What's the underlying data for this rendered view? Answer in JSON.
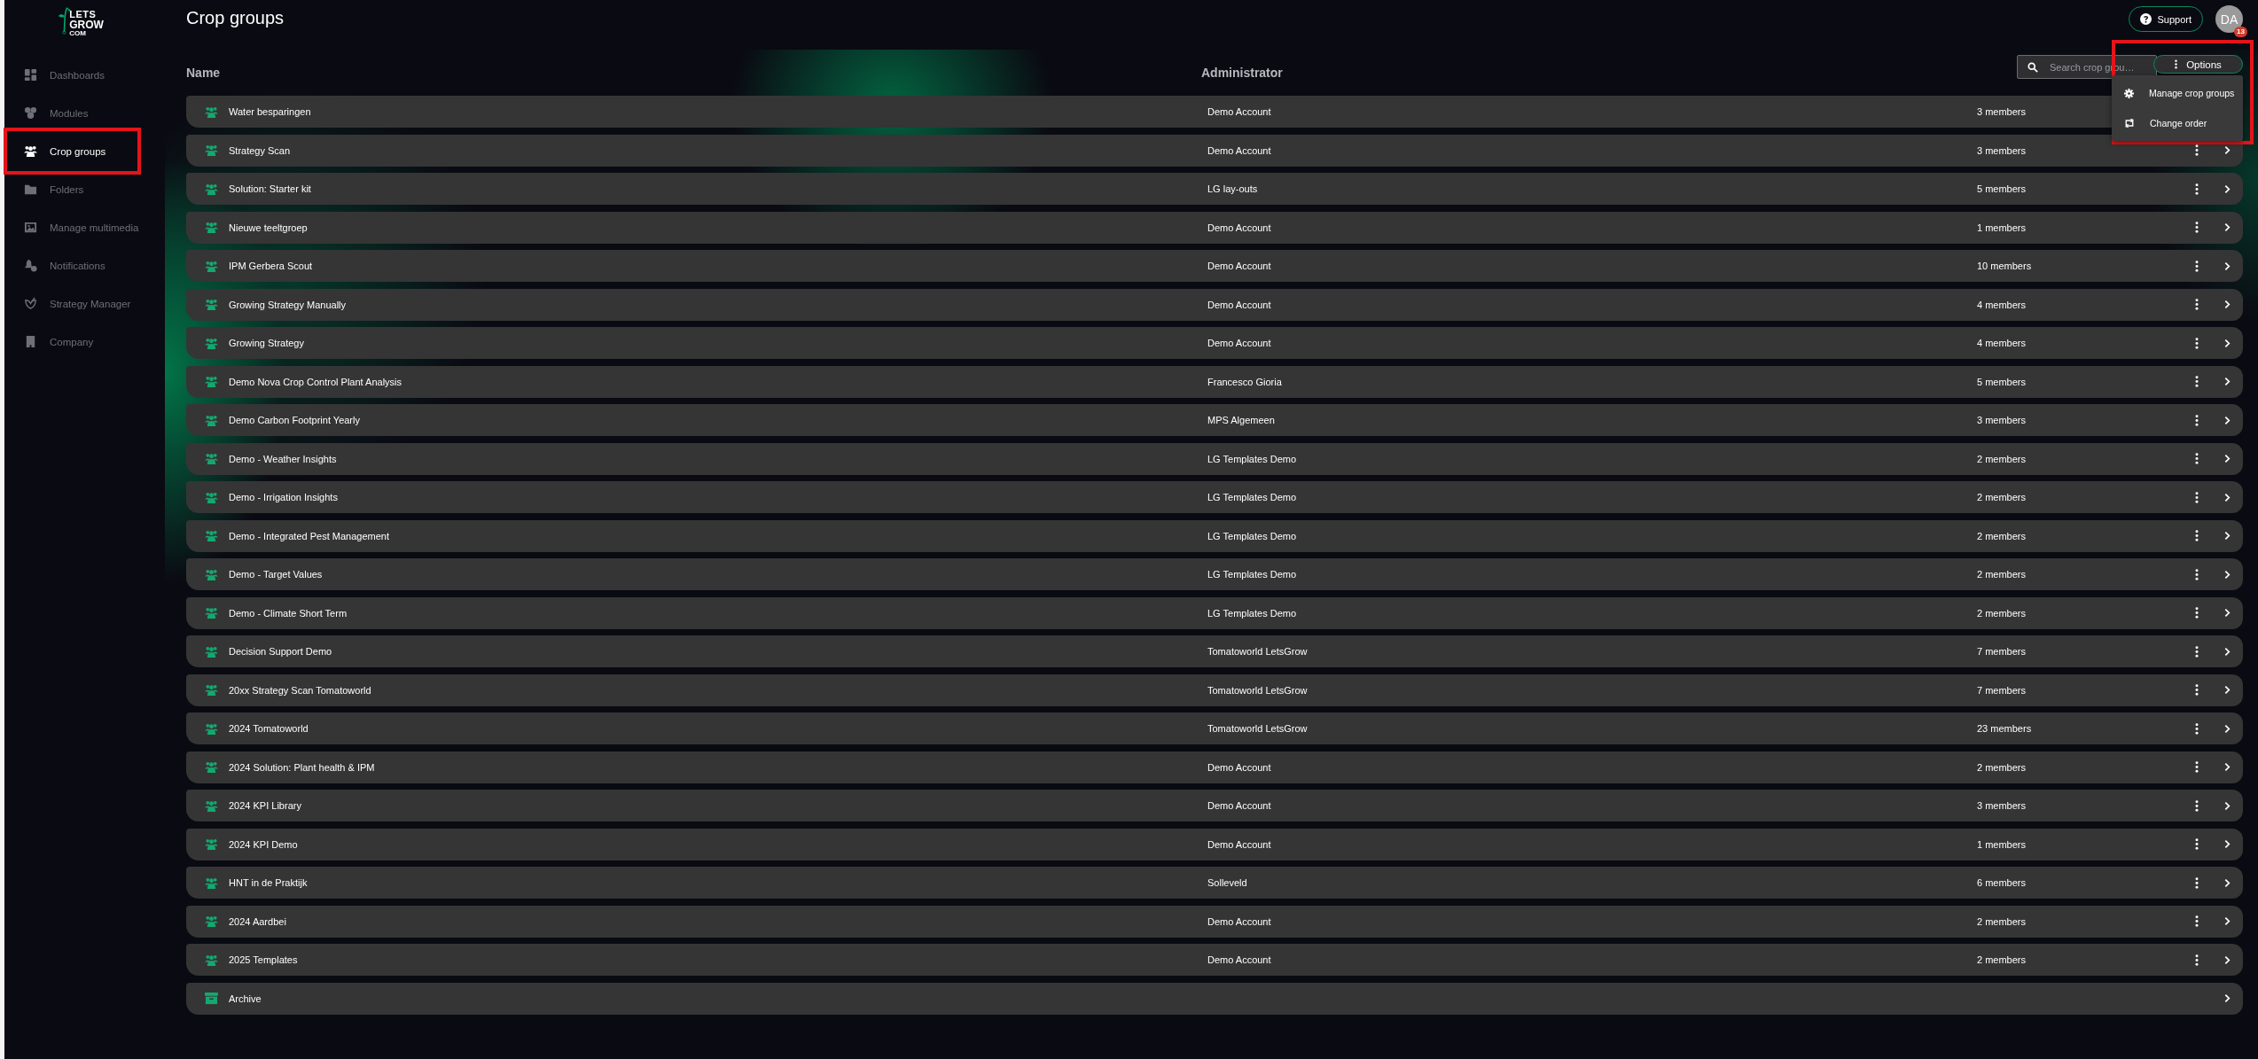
{
  "logo": {
    "line1": "LETS",
    "line2": "GROW",
    "line3": "COM"
  },
  "sidebar": {
    "items": [
      {
        "label": "Dashboards",
        "selected": false,
        "highlighted": false
      },
      {
        "label": "Modules",
        "selected": false,
        "highlighted": false
      },
      {
        "label": "Crop groups",
        "selected": true,
        "highlighted": true
      },
      {
        "label": "Folders",
        "selected": false,
        "highlighted": false
      },
      {
        "label": "Manage multimedia",
        "selected": false,
        "highlighted": false
      },
      {
        "label": "Notifications",
        "selected": false,
        "highlighted": false
      },
      {
        "label": "Strategy Manager",
        "selected": false,
        "highlighted": false
      },
      {
        "label": "Company",
        "selected": false,
        "highlighted": false
      }
    ]
  },
  "header": {
    "title": "Crop groups",
    "support": "Support",
    "avatar": "DA",
    "badge": "13"
  },
  "table": {
    "columns": [
      "Name",
      "Administrator"
    ],
    "search": {
      "placeholder": "Search crop grou…"
    },
    "options": {
      "label": "Options",
      "highlighted": true,
      "menu": [
        "Manage crop groups",
        "Change order"
      ]
    },
    "rows": [
      {
        "kind": "group",
        "name": "Water besparingen",
        "admin": "Demo Account",
        "members": "3 members"
      },
      {
        "kind": "group",
        "name": "Strategy Scan",
        "admin": "Demo Account",
        "members": "3 members"
      },
      {
        "kind": "group",
        "name": "Solution: Starter kit",
        "admin": "LG lay-outs",
        "members": "5 members"
      },
      {
        "kind": "group",
        "name": "Nieuwe teeltgroep",
        "admin": "Demo Account",
        "members": "1 members"
      },
      {
        "kind": "group",
        "name": "IPM Gerbera Scout",
        "admin": "Demo Account",
        "members": "10 members"
      },
      {
        "kind": "group",
        "name": "Growing Strategy Manually",
        "admin": "Demo Account",
        "members": "4 members"
      },
      {
        "kind": "group",
        "name": "Growing Strategy",
        "admin": "Demo Account",
        "members": "4 members"
      },
      {
        "kind": "group",
        "name": "Demo Nova Crop Control Plant Analysis",
        "admin": "Francesco Gioria",
        "members": "5 members"
      },
      {
        "kind": "group",
        "name": "Demo Carbon Footprint Yearly",
        "admin": "MPS Algemeen",
        "members": "3 members"
      },
      {
        "kind": "group",
        "name": "Demo - Weather Insights",
        "admin": "LG Templates Demo",
        "members": "2 members"
      },
      {
        "kind": "group",
        "name": "Demo - Irrigation Insights",
        "admin": "LG Templates Demo",
        "members": "2 members"
      },
      {
        "kind": "group",
        "name": "Demo - Integrated Pest Management",
        "admin": "LG Templates Demo",
        "members": "2 members"
      },
      {
        "kind": "group",
        "name": "Demo - Target Values",
        "admin": "LG Templates Demo",
        "members": "2 members"
      },
      {
        "kind": "group",
        "name": "Demo - Climate Short Term",
        "admin": "LG Templates Demo",
        "members": "2 members"
      },
      {
        "kind": "group",
        "name": "Decision Support Demo",
        "admin": "Tomatoworld LetsGrow",
        "members": "7 members"
      },
      {
        "kind": "group",
        "name": "20xx Strategy Scan Tomatoworld",
        "admin": "Tomatoworld LetsGrow",
        "members": "7 members"
      },
      {
        "kind": "group",
        "name": "2024 Tomatoworld",
        "admin": "Tomatoworld LetsGrow",
        "members": "23 members"
      },
      {
        "kind": "group",
        "name": "2024 Solution: Plant health & IPM",
        "admin": "Demo Account",
        "members": "2 members"
      },
      {
        "kind": "group",
        "name": "2024 KPI Library",
        "admin": "Demo Account",
        "members": "3 members"
      },
      {
        "kind": "group",
        "name": "2024 KPI Demo",
        "admin": "Demo Account",
        "members": "1 members"
      },
      {
        "kind": "group",
        "name": "HNT in de Praktijk",
        "admin": "Solleveld",
        "members": "6 members"
      },
      {
        "kind": "group",
        "name": "2024 Aardbei",
        "admin": "Demo Account",
        "members": "2 members"
      },
      {
        "kind": "group",
        "name": "2025 Templates",
        "admin": "Demo Account",
        "members": "2 members"
      },
      {
        "kind": "archive",
        "name": "Archive"
      }
    ]
  }
}
